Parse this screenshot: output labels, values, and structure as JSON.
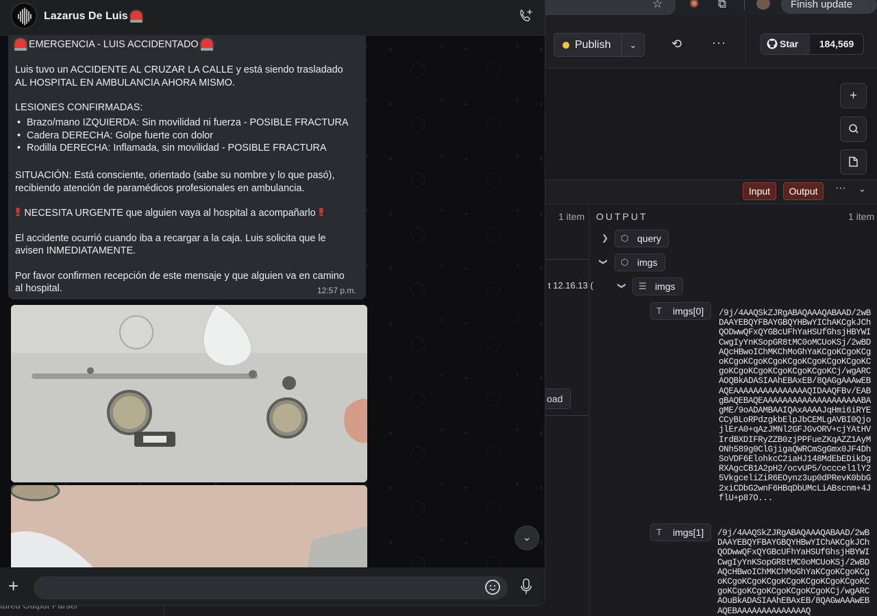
{
  "browser": {
    "finish_update_label": "Finish update",
    "star_icon": "☆",
    "more_icon": "⋮"
  },
  "editor": {
    "publish_label": "Publish",
    "publish_dot_color": "#f5c242",
    "history_icon": "⟲",
    "more_icon": "···",
    "github": {
      "star_label": "Star",
      "star_count": "184,569"
    },
    "side_buttons": {
      "add": "+",
      "search": "⌕",
      "note": "▭"
    },
    "panel": {
      "input_tag": "Input",
      "output_tag": "Output",
      "more": "···",
      "caret": "⌄",
      "left_items_count": "1 item",
      "left_time_fragment": "t 12.16.13 (",
      "left_load_fragment": "oad",
      "output_title": "OUTPUT",
      "output_items_count": "1 item",
      "tree": {
        "query_label": "query",
        "imgs_label": "imgs",
        "imgs_list_label": "imgs",
        "img0_key": "imgs[0]",
        "img0_value": "/9j/4AAQSkZJRgABAQAAAQABAAD/2wBDAAYEBQYFBAYGBQYHBwYIChAKCgkJChQODwwQFxQYGBcUFhYaHSUfGhsjHBYWICwgIyYnKSopGR8tMC0oMCUoKSj/2wBDAQcHBwoIChMKChMoGhYaKCgoKCgoKCgoKCgoKCgoKCgoKCgoKCgoKCgoKCgoKCgoKCgoKCgoKCgoKCgoKCgoKCj/wgARCAOQBkADASIAAhEBAxEB/8QAGgAAAwEBAQEAAAAAAAAAAAAAAAQIDAAQFBv/EABgBAQEBAQEAAAAAAAAAAAAAAAAAAAABAgME/9oADAMBAAIQAxAAAAJqHmi6iRYECCyBLoRPdzgkbElpJbCEMLgAVBI0QjojlErA0+qAzJMNl2GFJGvORV+cjYAtHVIrdBXDIFRyZZB0zjPPFueZKqAZZ1AyMONh589g0ClGjigaQWRCmSgGmx0JF4DhSoVDF6ElohkcC2iaHJ148MdEbEDikDgRXAgcCB1A2pH2/ocvUP5/occcel1lY25VkgceliZiR6EOynz3up0dPRevK0bbG2xiCDbG2wnF6HBqDbUMcLiABscnm+4JflU+p87O...",
        "img1_key": "imgs[1]",
        "img1_value": "/9j/4AAQSkZJRgABAQAAAQABAAD/2wBDAAYEBQYFBAYGBQYHBwYIChAKCgkJChQODwwQFxQYGBcUFhYaHSUfGhsjHBYWICwgIyYnKSopGR8tMC0oMCUoKSj/2wBDAQcHBwoIChMKChMoGhYaKCgoKCgoKCgoKCgoKCgoKCgoKCgoKCgoKCgoKCgoKCgoKCgoKCgoKCgoKCgoKCgoKCj/wgARCAOuBkADASIAAhEBAxEB/8QAGwAAAwEBAQEBAAAAAAAAAAAAAAQ"
      }
    },
    "bottom_left_text": "tured Output Parser"
  },
  "whatsapp": {
    "chat_name": "Lazarus De Luis",
    "add_call_icon": "add-call",
    "message": {
      "title": "EMERGENCIA - LUIS ACCIDENTADO",
      "line1": "Luis tuvo un ACCIDENTE AL CRUZAR LA CALLE y está siendo trasladado",
      "line2": "AL HOSPITAL EN AMBULANCIA AHORA MISMO.",
      "injuries_heading": "LESIONES CONFIRMADAS:",
      "injuries": [
        "Brazo/mano IZQUIERDA: Sin movilidad ni fuerza - POSIBLE FRACTURA",
        "Cadera DERECHA: Golpe fuerte con dolor",
        "Rodilla DERECHA: Inflamada, sin movilidad - POSIBLE FRACTURA"
      ],
      "situation1": "SITUACIÓN: Está consciente, orientado (sabe su nombre y lo que pasó),",
      "situation2": "recibiendo atención de paramédicos profesionales en ambulancia.",
      "urgent": "NECESITA URGENTE que alguien vaya al hospital a acompañarlo",
      "accident1": "El accidente ocurrió cuando iba a recargar a la caja. Luis solicita que le",
      "accident2": "avisen INMEDIATAMENTE.",
      "confirm1": "Por favor confirmen recepción de este mensaje y que alguien va en camino",
      "confirm2": "al hospital.",
      "time": "12:57 p.m."
    },
    "composer_plus": "+",
    "scroll_down": "⌄"
  }
}
